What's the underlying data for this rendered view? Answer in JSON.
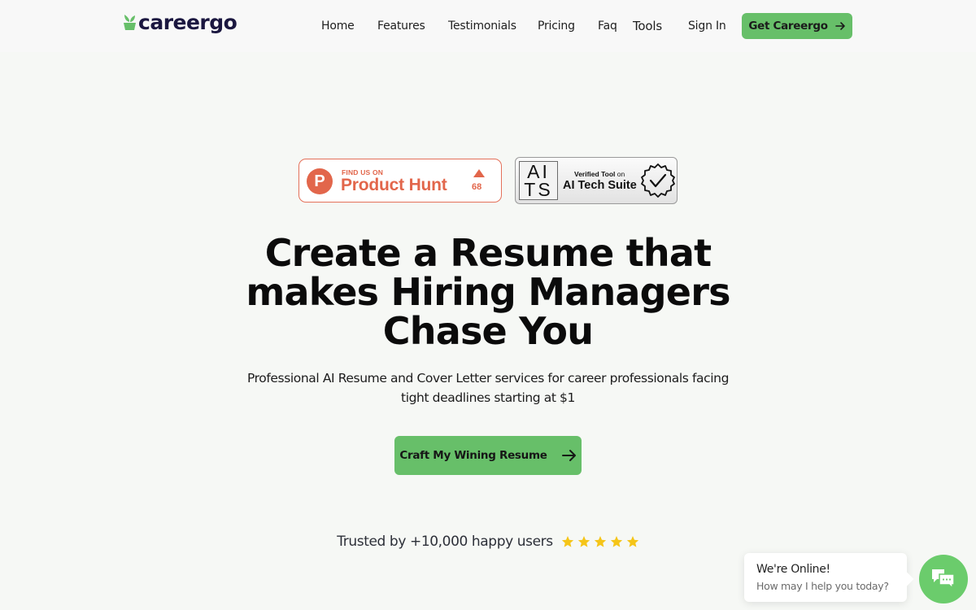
{
  "brand": {
    "name": "careergo",
    "accent_color": "#67bf69",
    "logo_color": "#1b1740"
  },
  "nav": {
    "links": [
      {
        "label": "Home"
      },
      {
        "label": "Features"
      },
      {
        "label": "Testimonials"
      },
      {
        "label": "Pricing"
      },
      {
        "label": "Faq"
      },
      {
        "label": "Tools"
      },
      {
        "label": "Sign In"
      }
    ],
    "cta_label": "Get Careergo",
    "cta_icon": "arrow-right-icon"
  },
  "badges": {
    "product_hunt": {
      "eyebrow": "FIND US ON",
      "title": "Product Hunt",
      "logo_letter": "P",
      "upvotes": "68",
      "color": "#e2664b"
    },
    "ai_tech_suite": {
      "logo_top": "AI",
      "logo_bottom": "TS",
      "eyebrow_bold": "Verified Tool",
      "eyebrow_rest": " on",
      "title": "AI Tech Suite",
      "seal_icon": "verified-check-seal-icon"
    }
  },
  "hero": {
    "title_lines": [
      "Create a Resume that",
      "makes Hiring Managers",
      "Chase You"
    ],
    "subtitle": "Professional AI Resume and Cover Letter services for career professionals facing tight deadlines starting at $1",
    "cta_label": "Craft My Wining Resume",
    "cta_icon": "arrow-right-icon"
  },
  "social_proof": {
    "text": "Trusted by +10,000 happy users",
    "rating": 5,
    "rating_max": 5,
    "star_color": "#f5c518"
  },
  "chat": {
    "title": "We're Online!",
    "subtitle": "How may I help you today?",
    "launcher_icon": "chat-bubbles-icon",
    "launcher_color": "#6bcc6c"
  }
}
